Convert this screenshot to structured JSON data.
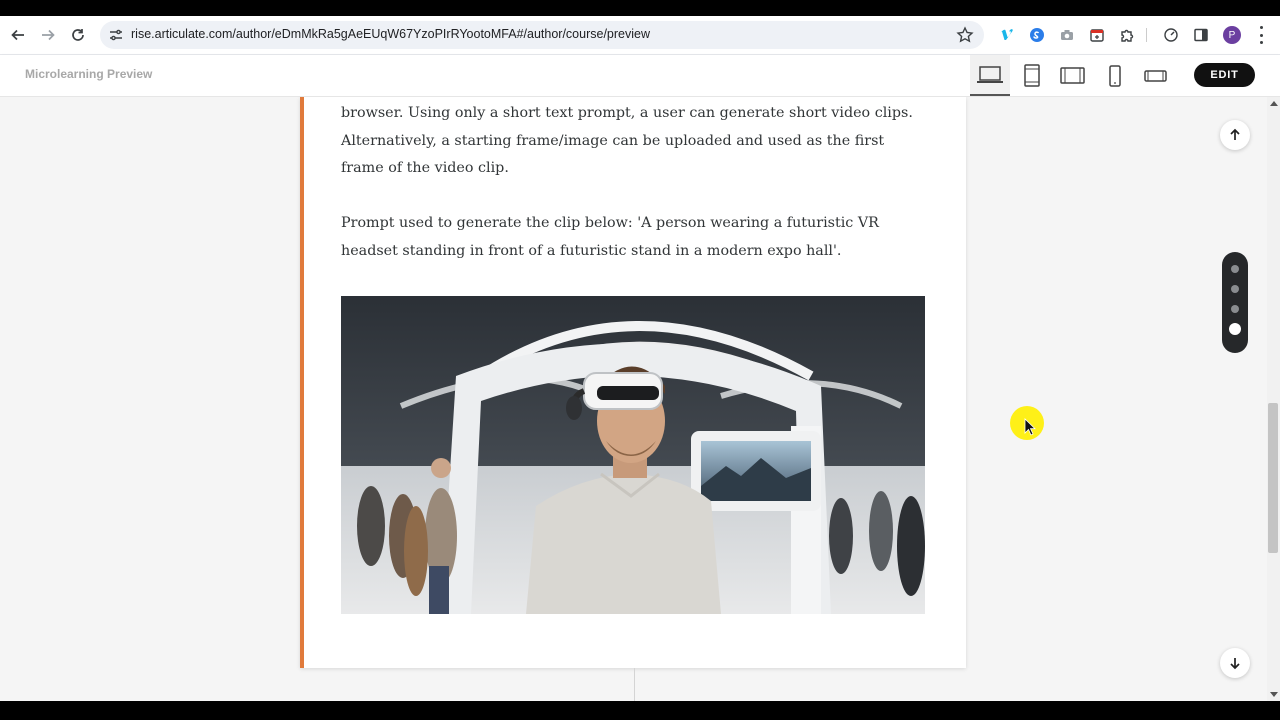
{
  "browser": {
    "url": "rise.articulate.com/author/eDmMkRa5gAeEUqW67YzoPIrRYootoMFA#/author/course/preview",
    "profile_initial": "P",
    "icons": {
      "back": "back-arrow-icon",
      "forward": "forward-arrow-icon",
      "reload": "reload-icon",
      "site_info": "tune-icon",
      "bookmark": "star-icon",
      "extensions": [
        "vimeo-icon",
        "sync-icon",
        "camera-icon",
        "calendar-icon",
        "puzzle-icon",
        "speed-icon",
        "side-panel-icon"
      ],
      "menu": "kebab-menu-icon"
    }
  },
  "app": {
    "title": "Microlearning Preview",
    "edit_label": "EDIT",
    "device_modes": [
      "desktop",
      "tablet-portrait",
      "tablet-landscape",
      "phone-portrait",
      "phone-landscape"
    ],
    "active_device": "desktop"
  },
  "content": {
    "paragraph1": "browser. Using only a short text prompt, a user can generate short video clips.  Alternatively, a starting frame/image can be uploaded and used as the first frame of the video clip.",
    "paragraph2": "Prompt used to generate the clip below: 'A person wearing a futuristic VR headset standing in front of a futuristic stand in a modern expo hall'.",
    "accent_color": "#e07a3b"
  },
  "lesson_nav": {
    "total": 4,
    "current": 4
  }
}
